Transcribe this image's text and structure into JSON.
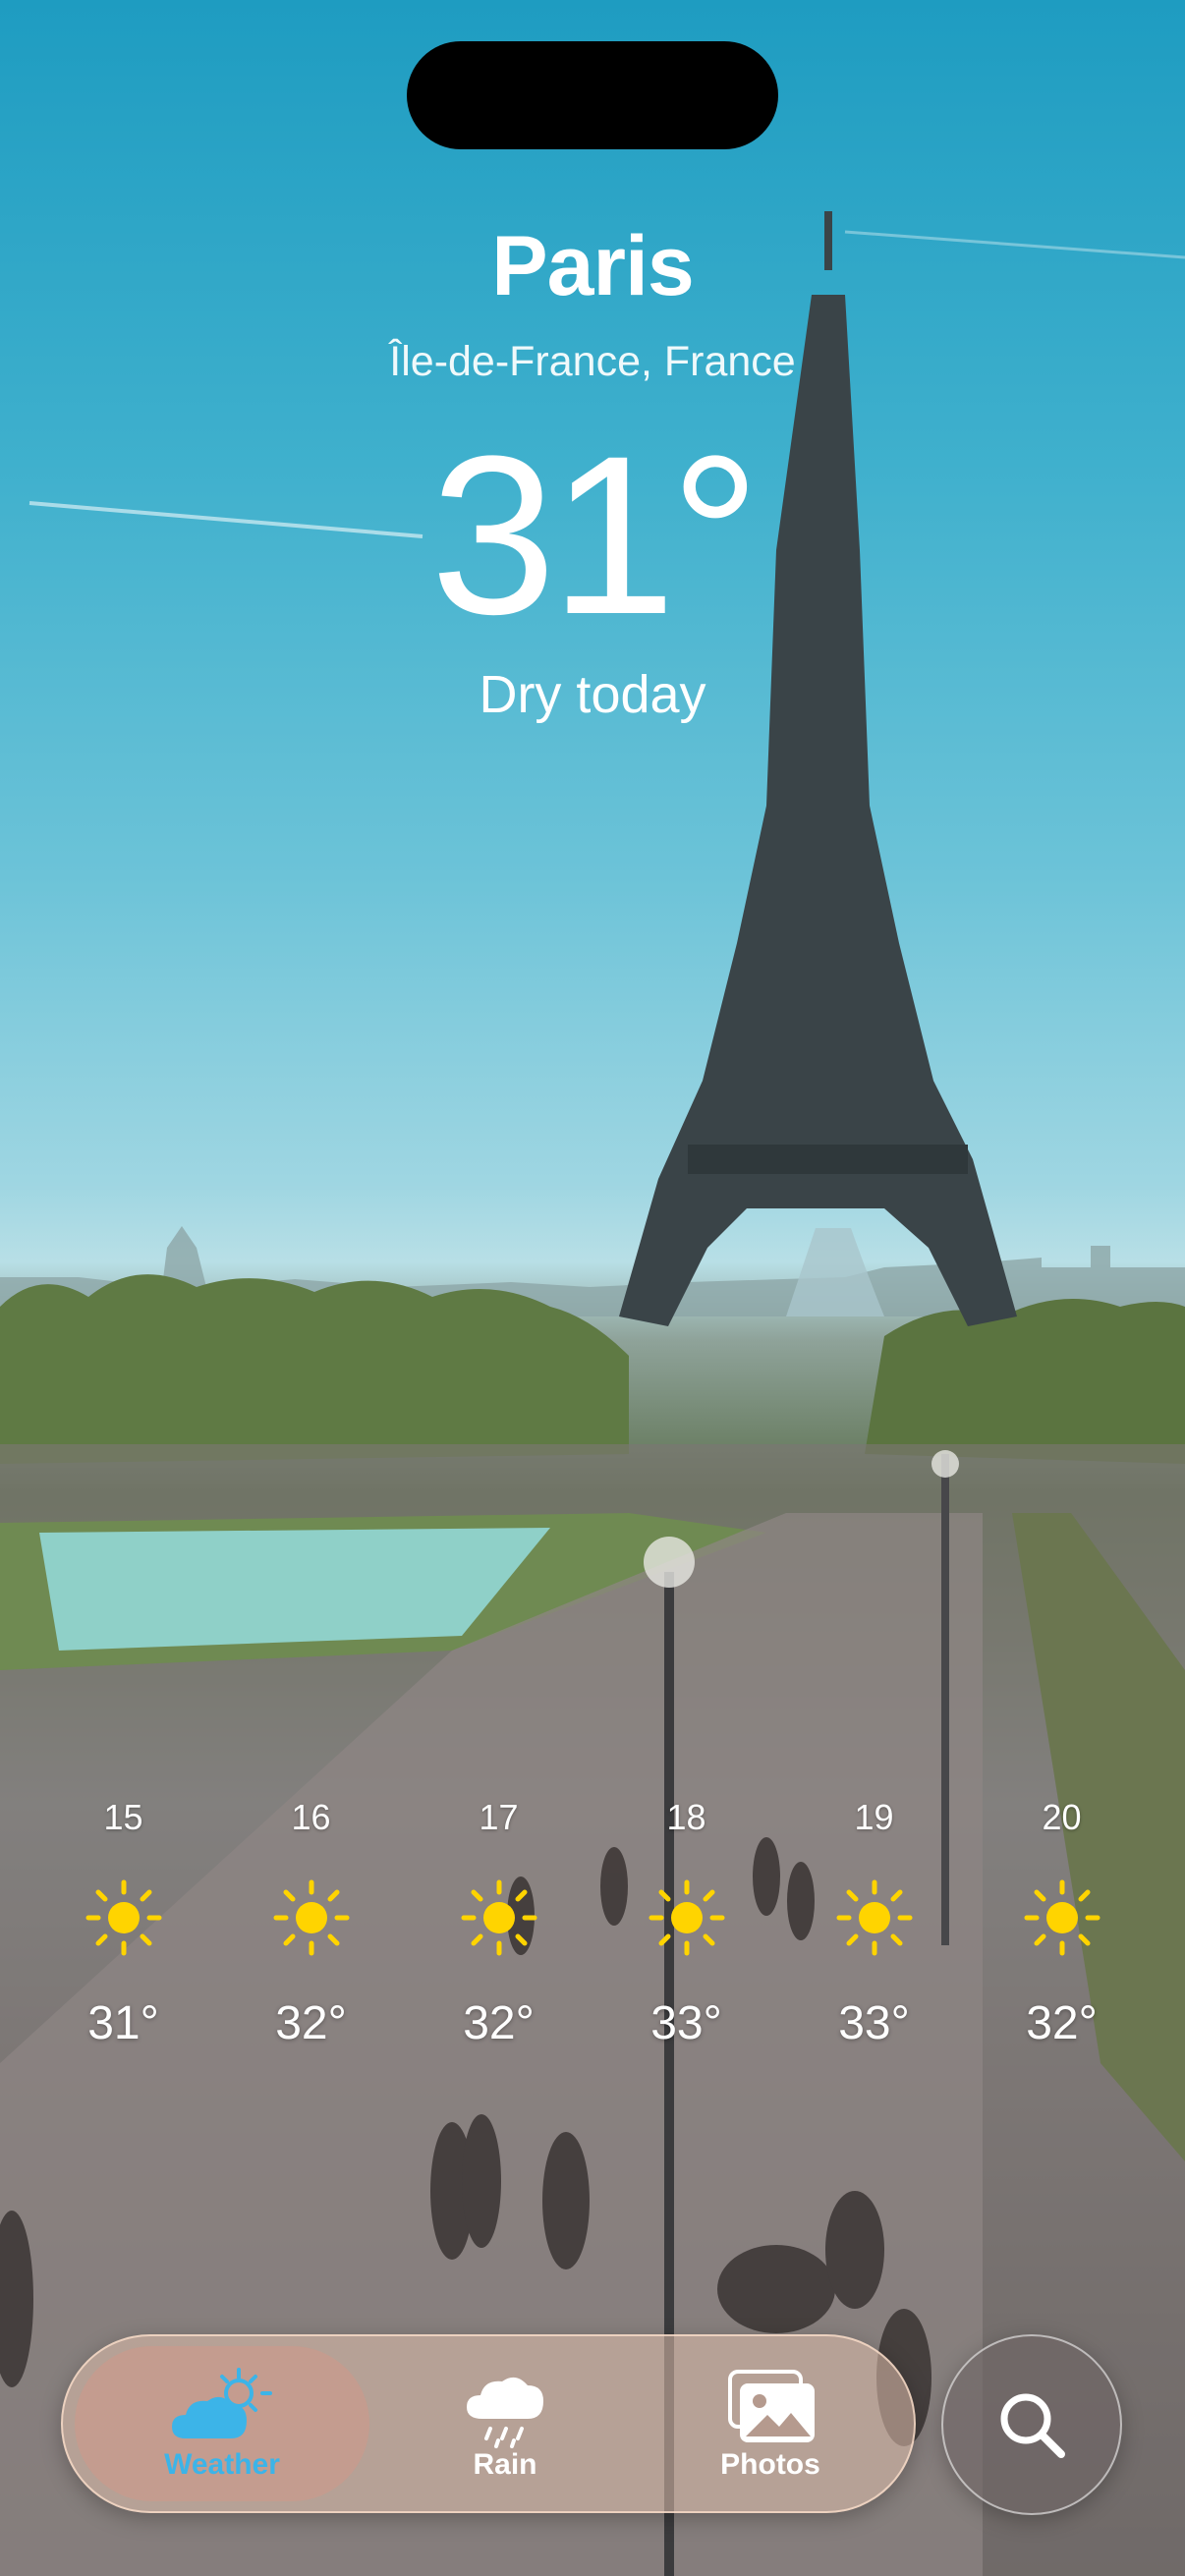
{
  "location": {
    "city": "Paris",
    "region": "Île-de-France, France",
    "temperature": "31°",
    "condition": "Dry today"
  },
  "hourly": [
    {
      "hour": "15",
      "icon": "sun-icon",
      "temp": "31°"
    },
    {
      "hour": "16",
      "icon": "sun-icon",
      "temp": "32°"
    },
    {
      "hour": "17",
      "icon": "sun-icon",
      "temp": "32°"
    },
    {
      "hour": "18",
      "icon": "sun-icon",
      "temp": "33°"
    },
    {
      "hour": "19",
      "icon": "sun-icon",
      "temp": "33°"
    },
    {
      "hour": "20",
      "icon": "sun-icon",
      "temp": "32°"
    }
  ],
  "tabs": {
    "weather": {
      "label": "Weather",
      "icon": "cloud-sun-icon",
      "active": true
    },
    "rain": {
      "label": "Rain",
      "icon": "cloud-rain-icon"
    },
    "photos": {
      "label": "Photos",
      "icon": "photos-icon"
    }
  },
  "search": {
    "icon": "search-icon"
  },
  "colors": {
    "sun": "#FFD400",
    "active_tab": "#3CB4E8",
    "sky": "#1E9CC1"
  }
}
